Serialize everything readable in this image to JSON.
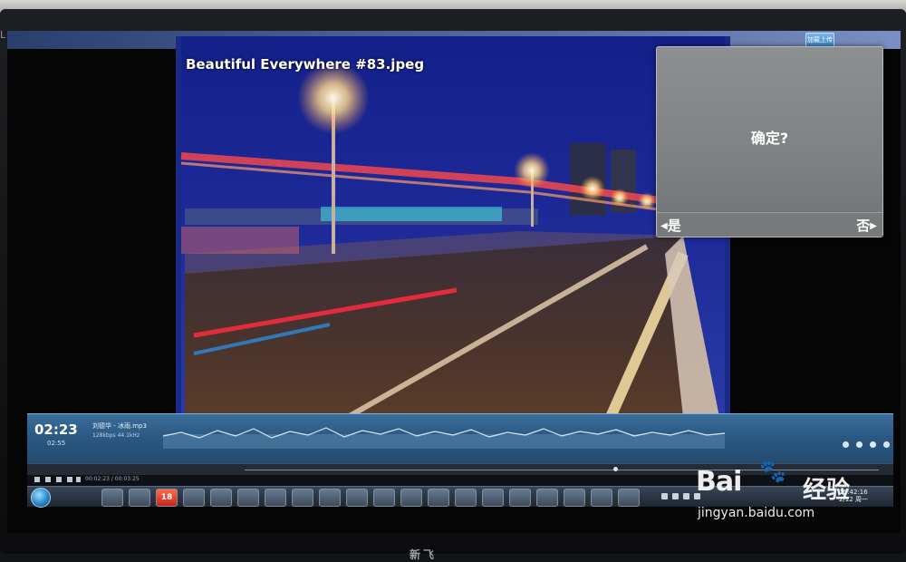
{
  "monitor": {
    "brand": "LEDIT",
    "stand_logo": "新飞"
  },
  "photo_viewer": {
    "title": "Beautiful Everywhere #83.jpeg"
  },
  "top_button": {
    "label": "加载上传"
  },
  "dialog": {
    "message": "确定?",
    "yes_label": "是",
    "no_label": "否"
  },
  "player": {
    "current_time": "02:23",
    "duration": "02:55",
    "track_title": "刘德华 - 冰雨.mp3",
    "track_info": "128kbps 44.1kHz",
    "control_time": "00:02:23 / 00:03:25"
  },
  "taskbar": {
    "badge_number": "18",
    "clock_time": "15:42:16",
    "clock_date": "2/12 周一"
  },
  "watermark": {
    "brand": "Bai",
    "suffix": "经验",
    "url": "jingyan.baidu.com"
  },
  "colors": {
    "photo_bg": "#1a2b86",
    "dialog_bg": "#7d8182",
    "player_bg": "#2b5983"
  },
  "icons": [
    "start-orb-icon",
    "paw-icon",
    "media-play-icon",
    "volume-icon"
  ]
}
